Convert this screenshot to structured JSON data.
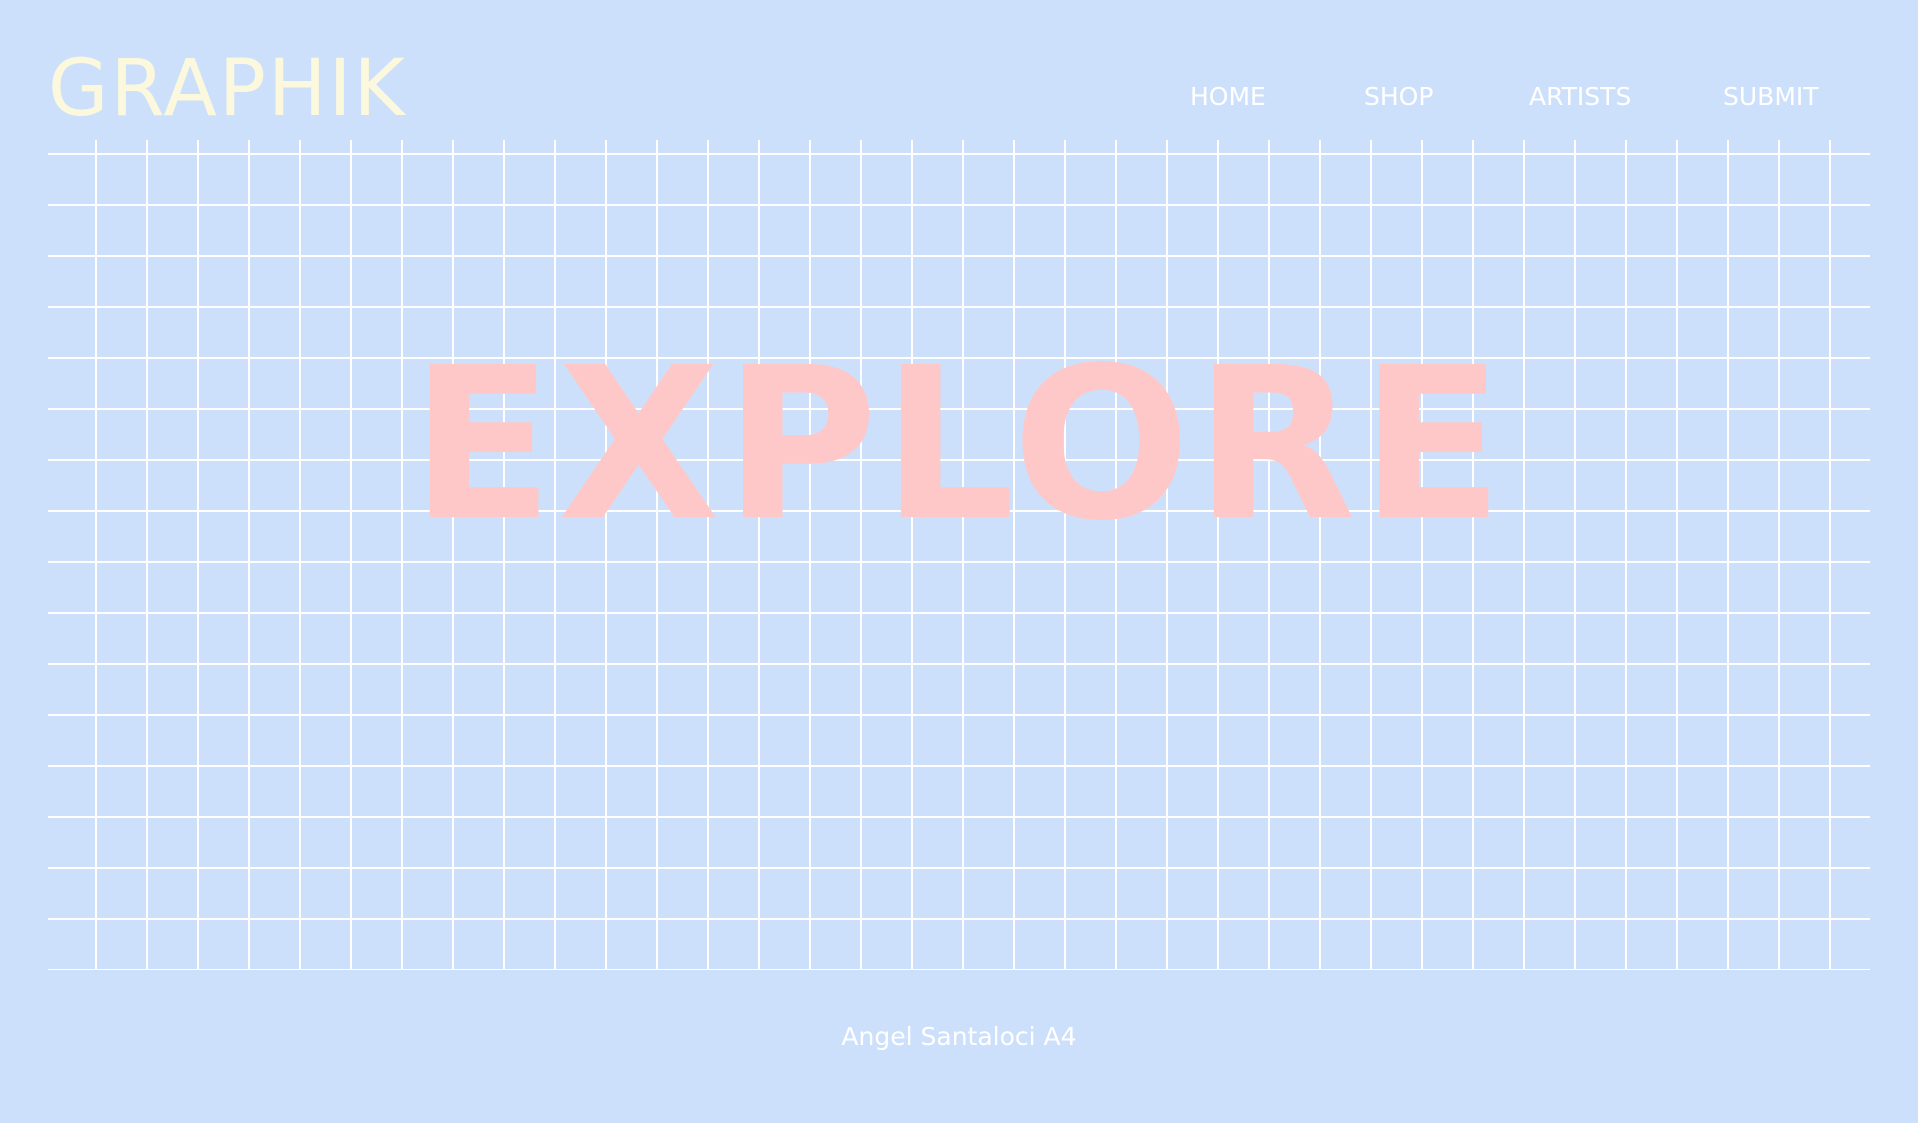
{
  "brand": {
    "logo_text": "GRAPHIK"
  },
  "nav": {
    "items": [
      {
        "label": "HOME"
      },
      {
        "label": "SHOP"
      },
      {
        "label": "ARTISTS"
      },
      {
        "label": "SUBMIT"
      }
    ]
  },
  "hero": {
    "title": "EXPLORE"
  },
  "footer": {
    "credit": "Angel Santaloci A4"
  },
  "colors": {
    "background": "#cde0fb",
    "grid_lines": "#ffffff",
    "logo": "#fbf8dd",
    "hero_text": "#ffc8c8",
    "nav_text": "#ffffff"
  }
}
